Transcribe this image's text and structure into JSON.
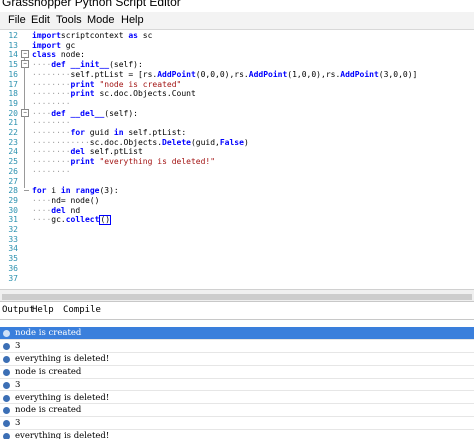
{
  "window": {
    "title": "Grasshopper Python Script Editor"
  },
  "menu": {
    "items": [
      "File",
      "Edit",
      "Tools",
      "Mode",
      "Help"
    ]
  },
  "editor": {
    "lines": [
      {
        "n": "12",
        "tokens": [
          [
            "kw",
            "import"
          ],
          [
            "",
            "scriptcontext "
          ],
          [
            "kw",
            "as"
          ],
          [
            "",
            " sc"
          ]
        ]
      },
      {
        "n": "13",
        "tokens": [
          [
            "kw",
            "import"
          ],
          [
            "",
            " gc"
          ]
        ]
      },
      {
        "n": "14",
        "tokens": [
          [
            "kw",
            "class"
          ],
          [
            "",
            " node:"
          ]
        ]
      },
      {
        "n": "15",
        "tokens": [
          [
            "dots",
            "····"
          ],
          [
            "kw",
            "def"
          ],
          [
            "",
            " "
          ],
          [
            "fn",
            "__init__"
          ],
          [
            "",
            "(self):"
          ]
        ]
      },
      {
        "n": "16",
        "tokens": [
          [
            "dots",
            "········"
          ],
          [
            "",
            "self.ptList = [rs."
          ],
          [
            "fn",
            "AddPoint"
          ],
          [
            "",
            "(0,0,0),rs."
          ],
          [
            "fn",
            "AddPoint"
          ],
          [
            "",
            "(1,0,0),rs."
          ],
          [
            "fn",
            "AddPoint"
          ],
          [
            "",
            "(3,0,0)]"
          ]
        ]
      },
      {
        "n": "17",
        "tokens": [
          [
            "dots",
            "········"
          ],
          [
            "kw",
            "print"
          ],
          [
            "",
            " "
          ],
          [
            "str",
            "\"node is created\""
          ]
        ]
      },
      {
        "n": "18",
        "tokens": [
          [
            "dots",
            "········"
          ],
          [
            "kw",
            "print"
          ],
          [
            "",
            " sc.doc.Objects.Count"
          ]
        ]
      },
      {
        "n": "19",
        "tokens": [
          [
            "dots",
            "········"
          ]
        ]
      },
      {
        "n": "20",
        "tokens": [
          [
            "dots",
            "····"
          ],
          [
            "kw",
            "def"
          ],
          [
            "",
            " "
          ],
          [
            "fn",
            "__del__"
          ],
          [
            "",
            "(self):"
          ]
        ]
      },
      {
        "n": "21",
        "tokens": [
          [
            "dots",
            "········"
          ]
        ]
      },
      {
        "n": "22",
        "tokens": [
          [
            "dots",
            "········"
          ],
          [
            "kw",
            "for"
          ],
          [
            "",
            " guid "
          ],
          [
            "kw",
            "in"
          ],
          [
            "",
            " self.ptList:"
          ]
        ]
      },
      {
        "n": "23",
        "tokens": [
          [
            "dots",
            "············"
          ],
          [
            "",
            "sc.doc.Objects."
          ],
          [
            "fn",
            "Delete"
          ],
          [
            "",
            "(guid,"
          ],
          [
            "kw",
            "False"
          ],
          [
            "",
            ")"
          ]
        ]
      },
      {
        "n": "24",
        "tokens": [
          [
            "dots",
            "········"
          ],
          [
            "kw",
            "del"
          ],
          [
            "",
            " self.ptList"
          ]
        ]
      },
      {
        "n": "25",
        "tokens": [
          [
            "dots",
            "········"
          ],
          [
            "kw",
            "print"
          ],
          [
            "",
            " "
          ],
          [
            "str",
            "\"everything is deleted!\""
          ]
        ]
      },
      {
        "n": "26",
        "tokens": [
          [
            "dots",
            "········"
          ]
        ]
      },
      {
        "n": "27",
        "tokens": []
      },
      {
        "n": "28",
        "tokens": [
          [
            "kw",
            "for"
          ],
          [
            "",
            " i "
          ],
          [
            "kw",
            "in"
          ],
          [
            "",
            " "
          ],
          [
            "fn",
            "range"
          ],
          [
            "",
            "(3):"
          ]
        ]
      },
      {
        "n": "29",
        "tokens": [
          [
            "dots",
            "····"
          ],
          [
            "",
            "nd= node()"
          ]
        ]
      },
      {
        "n": "30",
        "tokens": [
          [
            "dots",
            "····"
          ],
          [
            "kw",
            "del"
          ],
          [
            "",
            " nd"
          ]
        ]
      },
      {
        "n": "31",
        "tokens": [
          [
            "dots",
            "····"
          ],
          [
            "",
            "gc."
          ],
          [
            "fn",
            "collect"
          ],
          [
            "cursor",
            "()"
          ]
        ]
      },
      {
        "n": "32",
        "tokens": []
      },
      {
        "n": "33",
        "tokens": []
      },
      {
        "n": "34",
        "tokens": []
      },
      {
        "n": "35",
        "tokens": []
      },
      {
        "n": "36",
        "tokens": []
      },
      {
        "n": "37",
        "tokens": []
      }
    ]
  },
  "bottom_tabs": {
    "output": "Output",
    "help": "Help",
    "compile": "Compile"
  },
  "output": {
    "rows": [
      "node is created",
      "3",
      "everything is deleted!",
      "node is created",
      "3",
      "everything is deleted!",
      "node is created",
      "3",
      "everything is deleted!"
    ],
    "selected_index": 0
  },
  "colors": {
    "keyword": "#0000ff",
    "string": "#a31515",
    "line_number": "#2b91af",
    "selection": "#3a7fdc"
  }
}
